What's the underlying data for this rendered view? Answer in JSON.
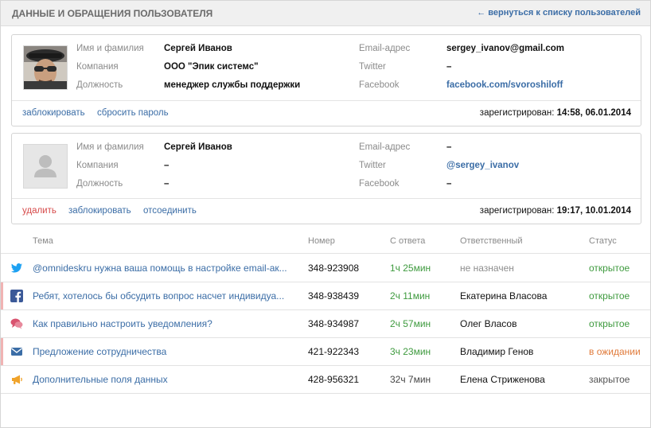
{
  "header": {
    "title": "ДАННЫЕ И ОБРАЩЕНИЯ ПОЛЬЗОВАТЕЛЯ",
    "back_link": "← вернуться к списку пользователей"
  },
  "labels": {
    "name": "Имя и фамилия",
    "company": "Компания",
    "position": "Должность",
    "email": "Email-адрес",
    "twitter": "Twitter",
    "facebook": "Facebook",
    "registered": "зарегистрирован:"
  },
  "cards": [
    {
      "name": "Сергей Иванов",
      "company": "ООО \"Эпик системс\"",
      "position": "менеджер службы поддержки",
      "email": "sergey_ivanov@gmail.com",
      "twitter": "–",
      "facebook": "facebook.com/svoroshiloff",
      "actions": [
        "заблокировать",
        "сбросить пароль"
      ],
      "registered_at": "14:58, 06.01.2014"
    },
    {
      "name": "Сергей Иванов",
      "company": "–",
      "position": "–",
      "email": "–",
      "twitter": "@sergey_ivanov",
      "facebook": "–",
      "actions": [
        "удалить",
        "заблокировать",
        "отсоединить"
      ],
      "registered_at": "19:17, 10.01.2014"
    }
  ],
  "table": {
    "columns": [
      "Тема",
      "Номер",
      "С ответа",
      "Ответственный",
      "Статус"
    ],
    "rows": [
      {
        "channel": "twitter-icon",
        "subject": "@omnideskru нужна ваша помощь в настройке email-ак...",
        "number": "348-923908",
        "since": "1ч 25мин",
        "assignee": "не назначен",
        "status": "открытое"
      },
      {
        "channel": "facebook-icon",
        "subject": "Ребят, хотелось бы обсудить вопрос насчет индивидуа...",
        "number": "348-938439",
        "since": "2ч 11мин",
        "assignee": "Екатерина Власова",
        "status": "открытое"
      },
      {
        "channel": "chat-icon",
        "subject": "Как правильно настроить уведомления?",
        "number": "348-934987",
        "since": "2ч 57мин",
        "assignee": "Олег Власов",
        "status": "открытое"
      },
      {
        "channel": "email-icon",
        "subject": "Предложение сотрудничества",
        "number": "421-922343",
        "since": "3ч 23мин",
        "assignee": "Владимир Генов",
        "status": "в ожидании"
      },
      {
        "channel": "megaphone-icon",
        "subject": "Дополнительные поля данных",
        "number": "428-956321",
        "since": "32ч 7мин",
        "assignee": "Елена Стриженова",
        "status": "закрытое"
      }
    ]
  },
  "colors": {
    "link": "#3b6da6",
    "open": "#3e9a3e",
    "waiting": "#e07a3a",
    "danger": "#d64a4a",
    "twitter": "#1da1f2",
    "facebook": "#3b5998",
    "chat": "#d9536f",
    "email": "#3b6da6",
    "megaphone": "#f0a32a"
  }
}
